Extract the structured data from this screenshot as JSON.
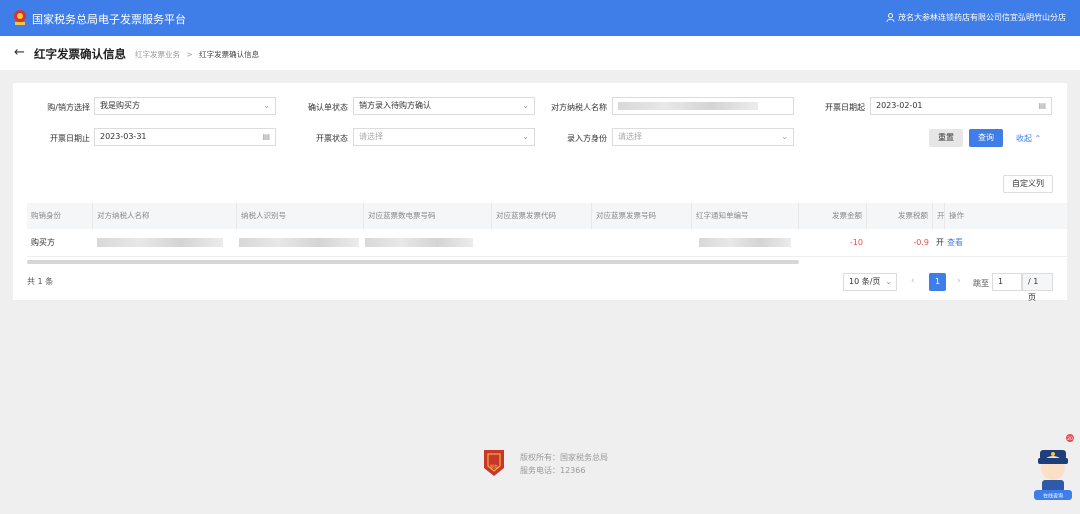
{
  "app": {
    "title": "国家税务总局电子发票服务平台",
    "user": "茂名大参林连锁药店有限公司信宜弘明竹山分店"
  },
  "page": {
    "title": "红字发票确认信息",
    "crumb_parent": "红字发票业务",
    "crumb_sep": ">",
    "crumb_current": "红字发票确认信息"
  },
  "filters": {
    "buyer_seller": {
      "label": "购/销方选择",
      "value": "我是购买方"
    },
    "confirm_status": {
      "label": "确认单状态",
      "value": "销方录入待购方确认"
    },
    "counterparty_name": {
      "label": "对方纳税人名称"
    },
    "date_start": {
      "label": "开票日期起",
      "value": "2023-02-01"
    },
    "date_end": {
      "label": "开票日期止",
      "value": "2023-03-31"
    },
    "invoice_status": {
      "label": "开票状态",
      "placeholder": "请选择"
    },
    "entry_identity": {
      "label": "录入方身份",
      "placeholder": "请选择"
    }
  },
  "actions": {
    "reset": "重置",
    "search": "查询",
    "collapse": "收起",
    "custom_columns": "自定义列"
  },
  "table": {
    "columns": [
      "购销身份",
      "对方纳税人名称",
      "纳税人识别号",
      "对应蓝票数电票号码",
      "对应蓝票发票代码",
      "对应蓝票发票号码",
      "红字通知单编号",
      "发票金额",
      "发票税额",
      "开",
      "操作"
    ],
    "rows": [
      {
        "identity": "购买方",
        "amount": "-10",
        "tax": "-0.9",
        "status": "开",
        "action": "查看"
      }
    ]
  },
  "pagination": {
    "total": "共 1 条",
    "page_size": "10 条/页",
    "current": "1",
    "goto_label": "跳至",
    "goto_value": "1",
    "of_pages": "/ 1 页"
  },
  "footer": {
    "copyright": "版权所有：国家税务总局",
    "phone": "服务电话：12366",
    "logo_text": "税务"
  },
  "colors": {
    "primary": "#3f7de8",
    "negative": "#e84d4d"
  },
  "mascot": {
    "badge": "20",
    "caption": "在线咨询"
  }
}
